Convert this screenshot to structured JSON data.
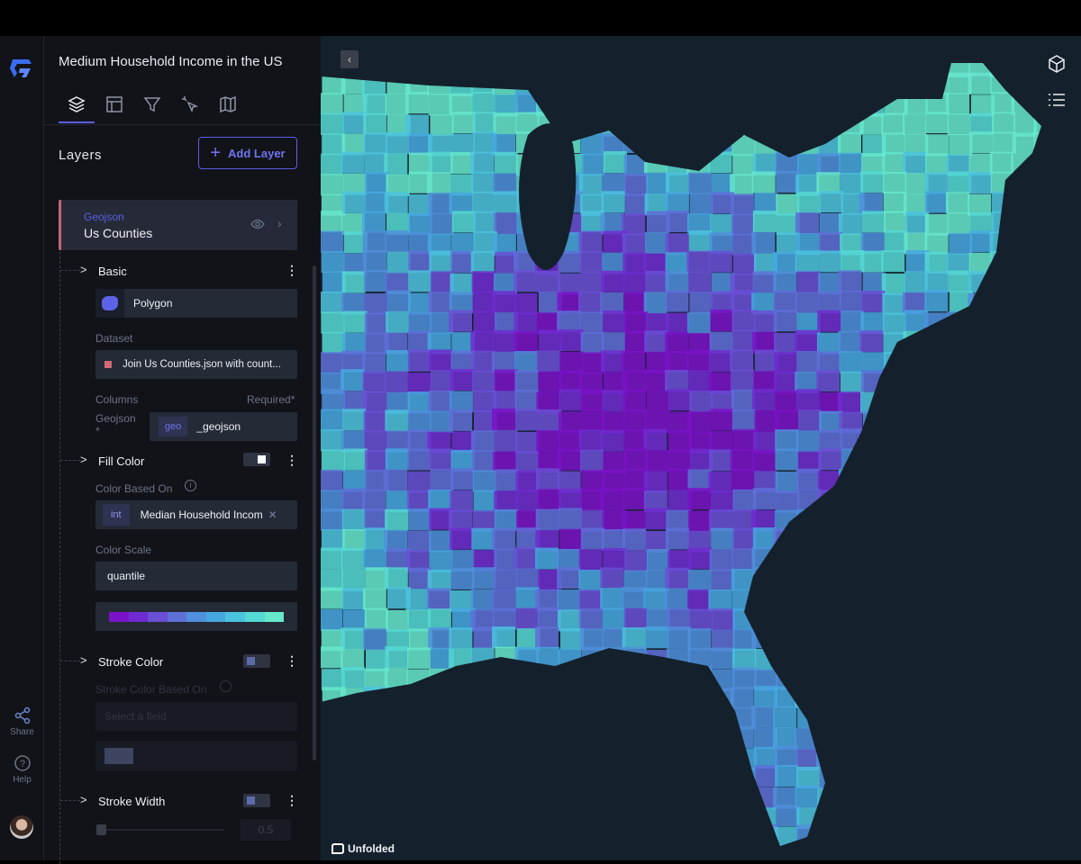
{
  "app": {
    "title": "Medium Household Income in the US",
    "brand": "Unfolded"
  },
  "rail": {
    "share": "Share",
    "help": "Help"
  },
  "tabs": [
    "layers",
    "table",
    "filter",
    "interaction",
    "map-style"
  ],
  "layers": {
    "heading": "Layers",
    "add_label": "Add Layer",
    "card": {
      "type": "Geojson",
      "name": "Us Counties"
    },
    "basic": {
      "label": "Basic",
      "layer_type": "Polygon",
      "dataset_label": "Dataset",
      "dataset": "Join Us Counties.json with count...",
      "columns_label": "Columns",
      "required_label": "Required*",
      "geojson_label": "Geojson",
      "geojson_star": "*",
      "geo_badge": "geo",
      "geo_field": "_geojson"
    },
    "fill": {
      "label": "Fill Color",
      "based_on_label": "Color Based On",
      "badge": "int",
      "field": "Median Household Incom",
      "scale_label": "Color Scale",
      "scale": "quantile",
      "palette": [
        "#7a12c8",
        "#6f2bd0",
        "#6a4fd6",
        "#5e6fd8",
        "#4f8fdc",
        "#47a7e0",
        "#4cc3de",
        "#55d8d4",
        "#66e8cc"
      ]
    },
    "stroke": {
      "label": "Stroke Color",
      "based_on_label": "Stroke Color Based On",
      "placeholder": "Select a field"
    },
    "width": {
      "label": "Stroke Width",
      "value": "0.5"
    }
  },
  "colors": {
    "accent": "#5a5ee0",
    "panel": "#121319",
    "map_bg": "#14212c"
  }
}
